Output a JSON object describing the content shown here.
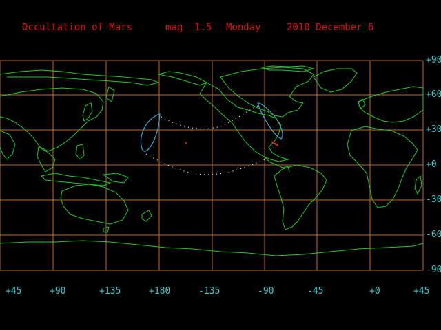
{
  "header": {
    "event": "Occultation of Mars",
    "magnitude": "mag  1.5",
    "weekday": "Monday",
    "date": "2010 December 6"
  },
  "lat_labels": [
    "+90",
    "+60",
    "+30",
    "+0",
    "-30",
    "-60",
    "-90"
  ],
  "lon_labels": [
    "+45",
    "+90",
    "+135",
    "+180",
    "-135",
    "-90",
    "-45",
    "+0",
    "+45"
  ],
  "colors": {
    "background": "#000000",
    "grid": "#c06a20",
    "coastline": "#22cc22",
    "title": "#e01010",
    "labels": "#33cccc",
    "limit_line": "#ffffff",
    "graze_curve": "#33aacc"
  },
  "map_legend": {
    "coastlines": "green-lines",
    "grid": "orange-lines",
    "limits": "white-dotted",
    "rise_set_curves": "cyan-lines"
  }
}
